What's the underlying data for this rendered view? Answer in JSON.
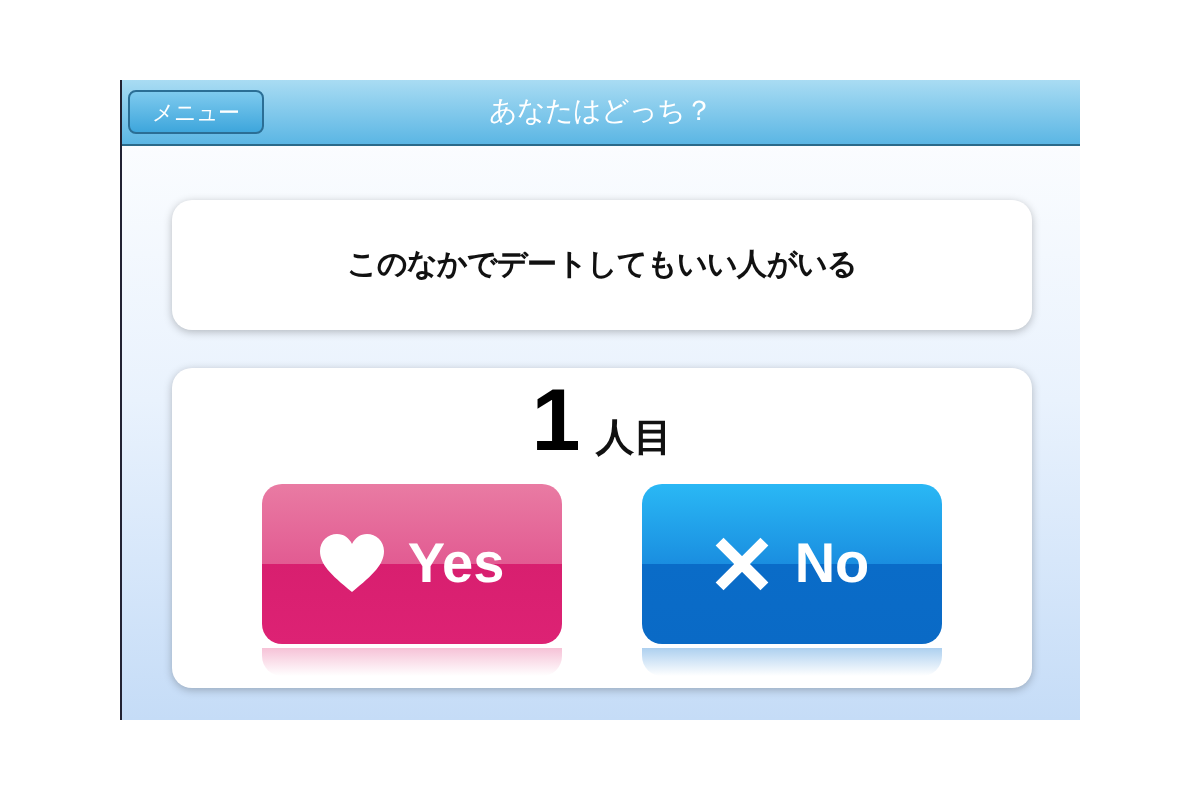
{
  "top_bar": {
    "menu_button": "メニュー",
    "title": "あなたはどっち？"
  },
  "question": "このなかでデートしてもいい人がいる",
  "counter": {
    "number": "1",
    "unit": "人目"
  },
  "answers": [
    {
      "kind": "yes",
      "label": "Yes"
    },
    {
      "kind": "no",
      "label": "No"
    }
  ]
}
